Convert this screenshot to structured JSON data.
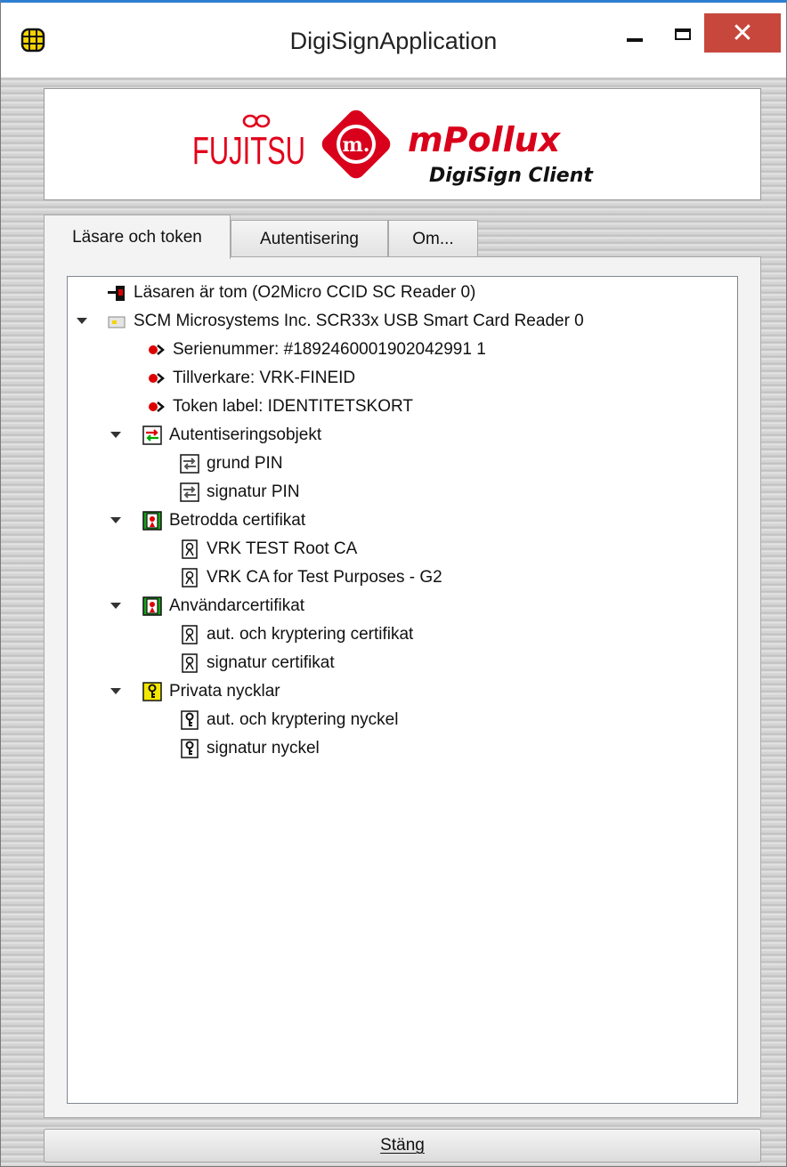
{
  "window": {
    "title": "DigiSignApplication",
    "close_glyph": "✕"
  },
  "logo": {
    "brand": "FUJITSU",
    "product": "mPollux",
    "subtitle": "DigiSign Client",
    "badge": "m."
  },
  "tabs": [
    {
      "label": "Läsare och token",
      "active": true
    },
    {
      "label": "Autentisering",
      "active": false
    },
    {
      "label": "Om...",
      "active": false
    }
  ],
  "tree": {
    "reader_empty": {
      "label": "Läsaren är tom (O2Micro CCID SC Reader 0)",
      "icon": "empty-reader-icon"
    },
    "reader": {
      "label": "SCM Microsystems Inc. SCR33x USB Smart Card Reader 0",
      "icon": "card-reader-icon"
    },
    "serial": "Serienummer: #1892460001902042991 1",
    "manufacturer": "Tillverkare: VRK-FINEID",
    "token_label": "Token label: IDENTITETSKORT",
    "auth_objects": {
      "label": "Autentiseringsobjekt",
      "items": [
        "grund PIN",
        "signatur PIN"
      ]
    },
    "trusted_certs": {
      "label": "Betrodda certifikat",
      "items": [
        "VRK TEST Root CA",
        "VRK CA for Test Purposes - G2"
      ]
    },
    "user_certs": {
      "label": "Användarcertifikat",
      "items": [
        "aut. och kryptering certifikat",
        "signatur certifikat"
      ]
    },
    "private_keys": {
      "label": "Privata nycklar",
      "items": [
        "aut. och kryptering nyckel",
        "signatur nyckel"
      ]
    }
  },
  "footer": {
    "close_button_label": "Stäng"
  },
  "colors": {
    "fujitsu_red": "#e2001a",
    "mpollux_red": "#d9001b",
    "close_red": "#c7473d",
    "title_accent": "#2f7fd1"
  }
}
